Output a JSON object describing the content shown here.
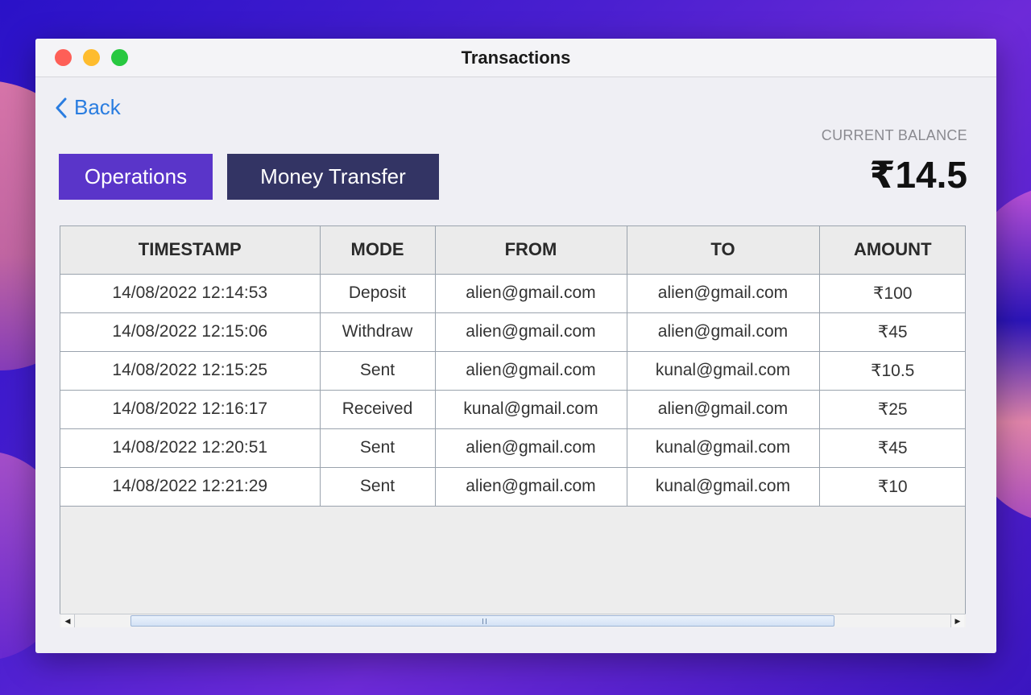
{
  "window": {
    "title": "Transactions"
  },
  "nav": {
    "back_label": "Back"
  },
  "balance": {
    "label": "CURRENT BALANCE",
    "value": "₹14.5"
  },
  "buttons": {
    "operations": "Operations",
    "money_transfer": "Money Transfer"
  },
  "colors": {
    "operations_button": "#5a35c9",
    "money_transfer_button": "#333464",
    "back_link": "#2a7de0"
  },
  "table": {
    "columns": [
      "TIMESTAMP",
      "MODE",
      "FROM",
      "TO",
      "AMOUNT"
    ],
    "rows": [
      [
        "14/08/2022 12:14:53",
        "Deposit",
        "alien@gmail.com",
        "alien@gmail.com",
        "₹100"
      ],
      [
        "14/08/2022 12:15:06",
        "Withdraw",
        "alien@gmail.com",
        "alien@gmail.com",
        "₹45"
      ],
      [
        "14/08/2022 12:15:25",
        "Sent",
        "alien@gmail.com",
        "kunal@gmail.com",
        "₹10.5"
      ],
      [
        "14/08/2022 12:16:17",
        "Received",
        "kunal@gmail.com",
        "alien@gmail.com",
        "₹25"
      ],
      [
        "14/08/2022 12:20:51",
        "Sent",
        "alien@gmail.com",
        "kunal@gmail.com",
        "₹45"
      ],
      [
        "14/08/2022 12:21:29",
        "Sent",
        "alien@gmail.com",
        "kunal@gmail.com",
        "₹10"
      ]
    ]
  }
}
